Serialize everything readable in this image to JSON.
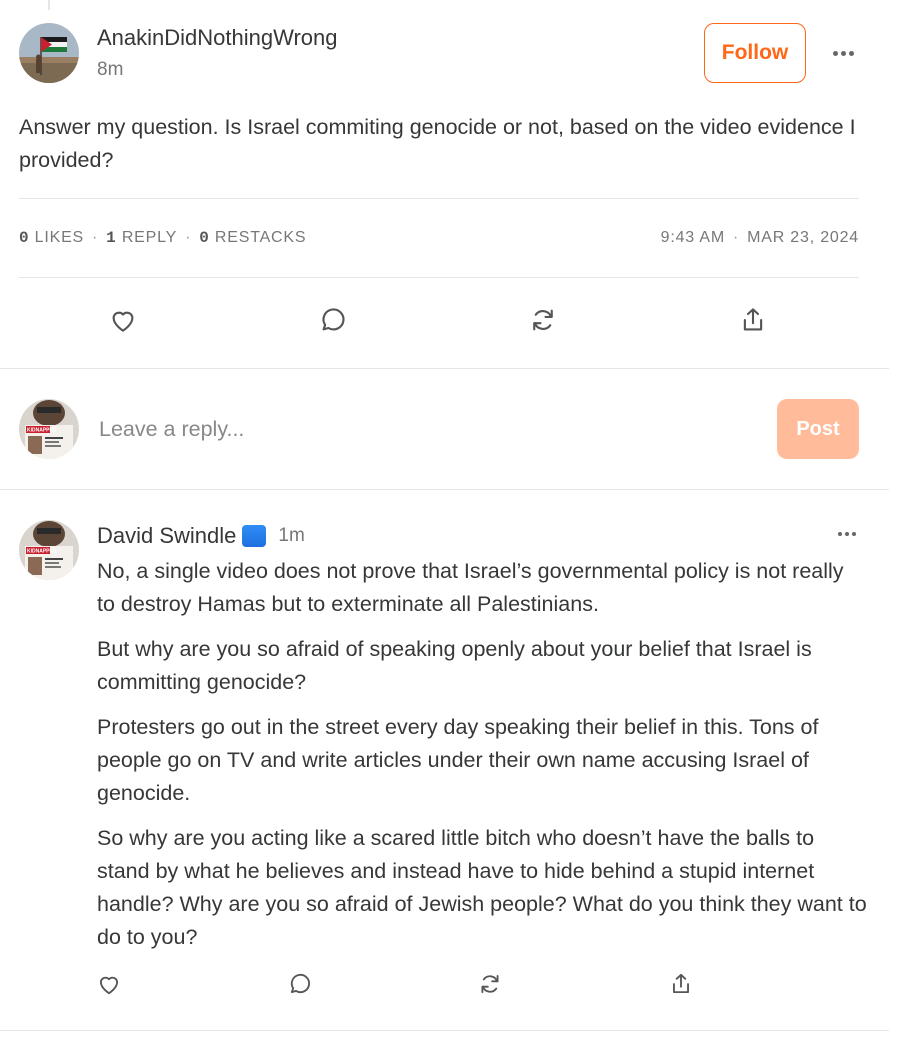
{
  "note": {
    "author": "AnakinDidNothingWrong",
    "time": "8m",
    "follow_label": "Follow",
    "body": "Answer my question. Is Israel commiting genocide or not, based on the video evidence I provided?",
    "stats": {
      "likes_count": "0",
      "likes_label": "LIKES",
      "replies_count": "1",
      "replies_label": "REPLY",
      "restacks_count": "0",
      "restacks_label": "RESTACKS",
      "time": "9:43 AM",
      "date": "MAR 23, 2024"
    },
    "actions": [
      "heart-icon",
      "comment-icon",
      "restack-icon",
      "share-icon"
    ]
  },
  "composer": {
    "placeholder": "Leave a reply...",
    "post_label": "Post"
  },
  "reply": {
    "author": "David Swindle",
    "badge_emoji": "🟦",
    "time": "1m",
    "paragraphs": [
      "No, a single video does not prove that Israel’s governmental policy is not really to destroy Hamas but to exterminate all Palestinians.",
      "But why are you so afraid of speaking openly about your belief that Israel is committing genocide?",
      "Protesters go out in the street every day speaking their belief in this. Tons of people go on TV and write articles under their own name accusing Israel of genocide.",
      "So why are you acting like a scared little bitch who doesn’t have the balls to stand by what he believes and instead have to hide behind a stupid internet handle? Why are you so afraid of Jewish people? What do you think they want to do to you?"
    ]
  },
  "avatar_labels": {
    "kidnapped": "KIDNAPPED"
  },
  "colors": {
    "accent": "#ff6719",
    "post_disabled": "#ffbb9a",
    "text": "#363737",
    "muted": "#777777",
    "divider": "#e6e6e6"
  }
}
